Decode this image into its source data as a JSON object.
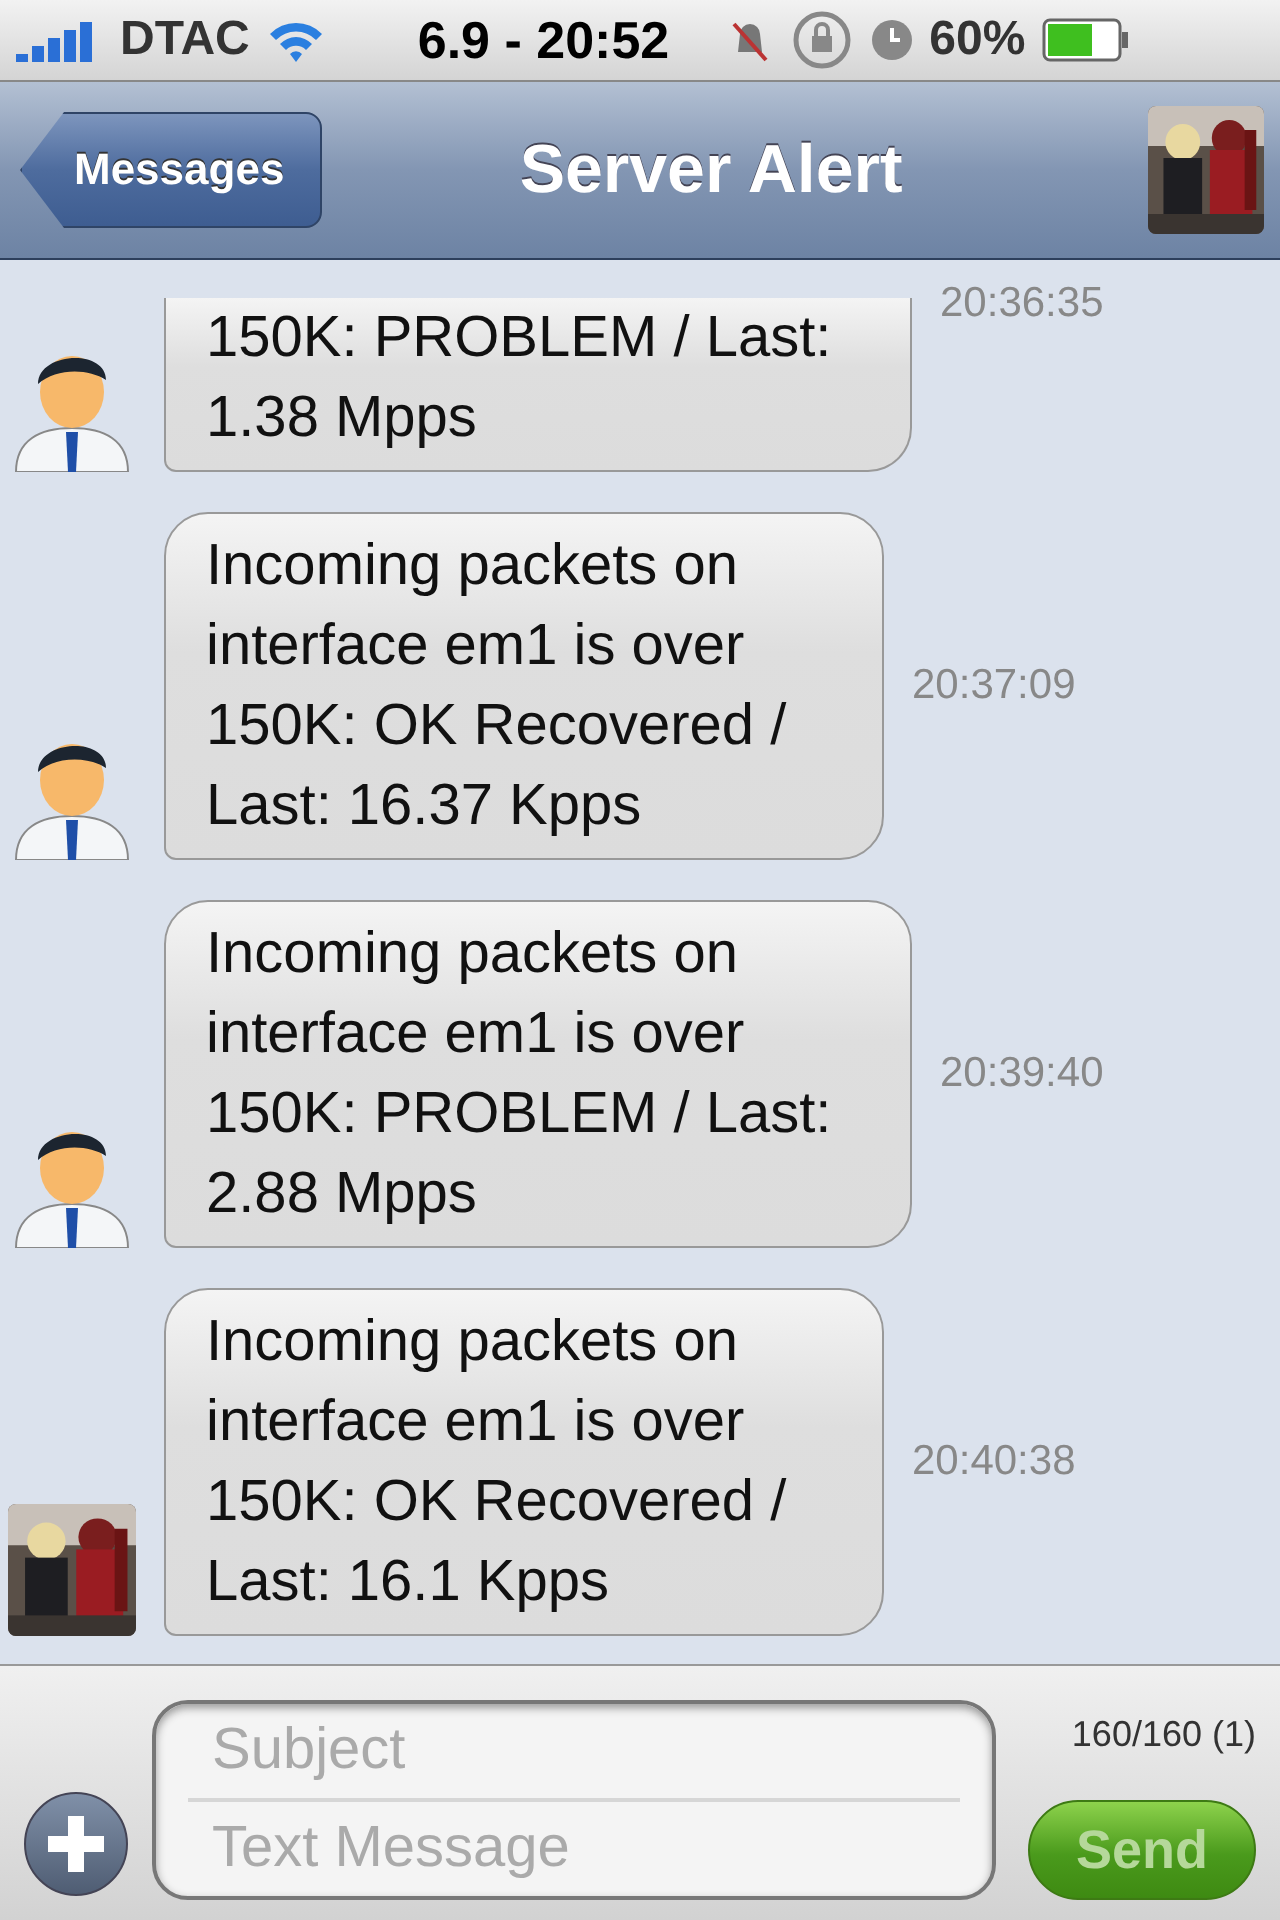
{
  "status_bar": {
    "carrier": "DTAC",
    "time": "6.9 - 20:52",
    "battery": "60%"
  },
  "nav_bar": {
    "back": "Messages",
    "title": "Server Alert"
  },
  "messages": [
    {
      "text": "150K: PROBLEM / Last: 1.38 Mpps",
      "time": "20:36:35",
      "cut": true,
      "avatar": {
        "kind": "person"
      }
    },
    {
      "text": "Incoming packets on interface em1 is over 150K: OK Recovered / Last: 16.37 Kpps",
      "time": "20:37:09",
      "cut": false,
      "avatar": {
        "kind": "person"
      }
    },
    {
      "text": "Incoming packets on interface em1 is over 150K: PROBLEM / Last: 2.88 Mpps",
      "time": "20:39:40",
      "cut": false,
      "avatar": {
        "kind": "person"
      }
    },
    {
      "text": "Incoming packets on interface em1 is over 150K: OK Recovered / Last: 16.1 Kpps",
      "time": "20:40:38",
      "cut": false
    }
  ],
  "composer": {
    "subject_placeholder": "Subject",
    "message_placeholder": "Text Message",
    "counter": "160/160 (1)",
    "send": "Send",
    "send_disabled": true
  }
}
